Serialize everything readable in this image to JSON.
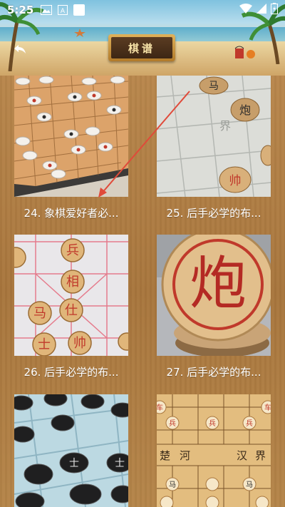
{
  "status_bar": {
    "time": "5:25",
    "icons": [
      "image-icon",
      "text-a-icon",
      "notification-square-icon",
      "wifi-icon",
      "signal-icon",
      "battery-charging-icon"
    ]
  },
  "header": {
    "title": "棋谱",
    "back_icon": "back-arrow-icon"
  },
  "colors": {
    "wood": "#a8763d",
    "plaque_gold": "#d9a24a",
    "plaque_dark": "#3d2614",
    "pointer_arrow": "#e04a3a"
  },
  "cards": [
    {
      "caption": "24. 象棋爱好者必..."
    },
    {
      "caption": "25. 后手必学的布..."
    },
    {
      "caption": "26. 后手必学的布..."
    },
    {
      "caption": "27. 后手必学的布..."
    },
    {
      "caption": ""
    },
    {
      "caption": ""
    }
  ],
  "thumb_text": {
    "t25": [
      "马",
      "炮",
      "界",
      "帅"
    ],
    "t26": [
      "兵",
      "相",
      "马",
      "仕",
      "士",
      "帅"
    ],
    "t27": [
      "炮"
    ],
    "t28": [
      "士",
      "士"
    ],
    "t29": [
      "楚",
      "河",
      "汉",
      "界",
      "车",
      "车",
      "兵",
      "兵",
      "兵",
      "马",
      "马"
    ]
  }
}
